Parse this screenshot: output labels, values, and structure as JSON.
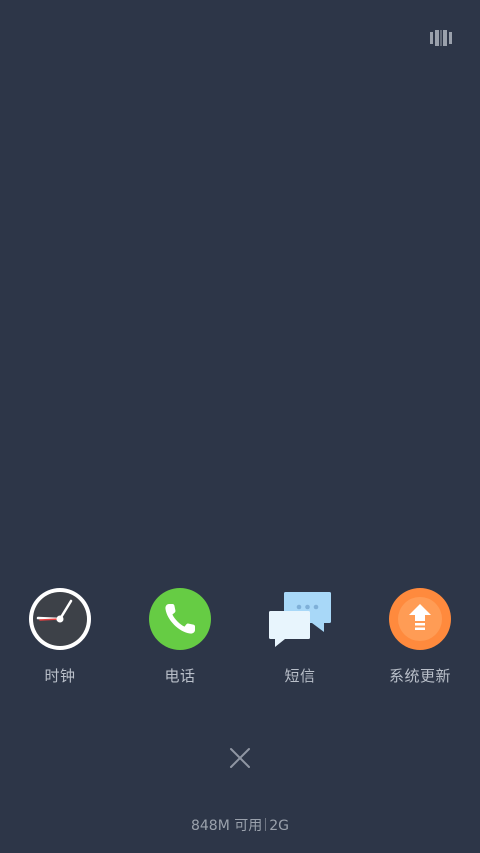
{
  "top_bar": {
    "view_toggle_icon": "card-view-icon"
  },
  "recent_apps": [
    {
      "label": "时钟",
      "icon": "clock-icon"
    },
    {
      "label": "电话",
      "icon": "phone-icon"
    },
    {
      "label": "短信",
      "icon": "message-icon"
    },
    {
      "label": "系统更新",
      "icon": "system-update-icon"
    }
  ],
  "bottom": {
    "close_icon": "close-icon",
    "memory_available": "848M 可用",
    "memory_total": "2G"
  },
  "colors": {
    "background": "#2d3648",
    "phone_green": "#66cc44",
    "update_orange": "#ff8a3d",
    "message_blue": "#a8d8f8",
    "label_gray": "#b9bfc9"
  }
}
